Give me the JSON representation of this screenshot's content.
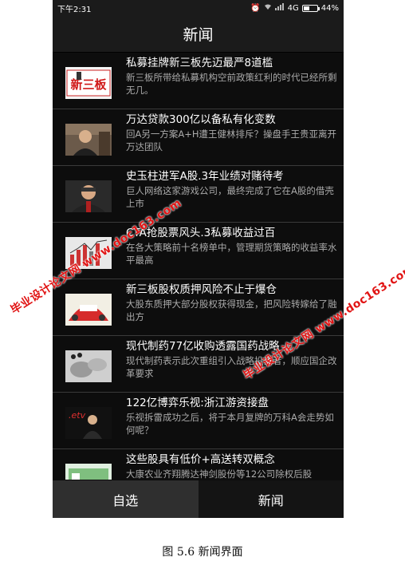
{
  "status_bar": {
    "time": "下午2:31",
    "network": "4G",
    "battery": "44%",
    "battery_level": 0.44,
    "icons": [
      "alarm-icon",
      "wifi-icon",
      "signal-icon",
      "battery-icon"
    ]
  },
  "header": {
    "title": "新闻"
  },
  "news": [
    {
      "title": "私募挂牌新三板先迈最严8道槛",
      "summary": "新三板所带给私募机构空前政策红利的时代已经所剩无几。",
      "thumb_text": "新三板"
    },
    {
      "title": "万达贷款300亿以备私有化变数",
      "summary": "回A另一方案A+H遭王健林排斥？操盘手王贵亚离开万达团队",
      "thumb_text": ""
    },
    {
      "title": "史玉柱进军A股.3年业绩对赌待考",
      "summary": "巨人网络这家游戏公司，最终完成了它在A股的借壳上市",
      "thumb_text": ""
    },
    {
      "title": "CTA抢股票风头.3私募收益过百",
      "summary": "在各大策略前十名榜单中，管理期货策略的收益率水平最高",
      "thumb_text": ""
    },
    {
      "title": "新三板股权质押风险不止于爆仓",
      "summary": "大股东质押大部分股权获得现金，把风险转嫁给了融出方",
      "thumb_text": ""
    },
    {
      "title": "现代制药77亿收购透露国药战略",
      "summary": "现代制药表示此次重组引入战略投资者，顺应国企改革要求",
      "thumb_text": ""
    },
    {
      "title": "122亿博弈乐视:浙江游资接盘",
      "summary": "乐视拆雷成功之后，将于本月复牌的万科A会走势如何呢？",
      "thumb_text": ".etv"
    },
    {
      "title": "这些股具有低价+高送转双概念",
      "summary": "大康农业齐翔腾达神剑股份等12公司除权后股",
      "thumb_text": ""
    }
  ],
  "nav": {
    "left_label": "自选",
    "right_label": "新闻"
  },
  "watermarks": [
    "毕业设计论文网 www.doc163.com",
    "毕业设计论文网 www.doc163.com"
  ],
  "caption": "图 5.6 新闻界面",
  "colors": {
    "background": "#0d0d0d",
    "bar": "#1b1b1b",
    "watermark": "#e11414"
  }
}
